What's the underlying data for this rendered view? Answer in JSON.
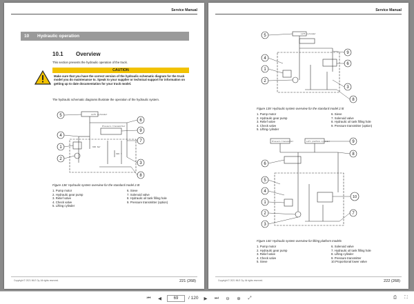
{
  "left_page": {
    "header": "Service Manual",
    "section_number": "10",
    "section_title": "Hydraulic operation",
    "subsection_number": "10.1",
    "subsection_title": "Overview",
    "intro": "This section presents the hydraulic operation of the truck.",
    "caution_title": "CAUTION",
    "caution_text": "Make sure that you have the correct version of the hydraulic schematic diagram for the truck model you do maintenance to. Speak to your supplier or technical support for information on getting up to date documentation for your truck model.",
    "body_text": "The hydraulic schematic diagrams illustrate the operation of the hydraulic system.",
    "figure_caption": "Figure 138: Hydraulic system overview for the standard model 2.0t",
    "legend_left": [
      "1. Pump motor",
      "2. Hydraulic gear pump",
      "3. Relief valve",
      "4. Check valve",
      "5. Lifting cylinder"
    ],
    "legend_right": [
      "6. Sieve",
      "7. Solenoid valve",
      "8. Hydraulic oil tank filling hole",
      "9. Pressure transmitter (option)"
    ],
    "footer_copyright": "Copyright © 2021 MLE Oy. All rights reserved.",
    "page_number": "221 (268)"
  },
  "right_page": {
    "header": "Service Manual",
    "figure1_caption": "Figure 139: Hydraulic system overview for the standard model 2.5t",
    "legend1_left": [
      "1. Pump motor",
      "2. Hydraulic gear pump",
      "3. Relief valve",
      "4. Check valve",
      "5. Lifting cylinder"
    ],
    "legend1_right": [
      "6. Sieve",
      "7. Solenoid valve",
      "8. Hydraulic oil tank filling hole",
      "9. Pressure transmitter (option)"
    ],
    "figure2_caption": "Figure 140: Hydraulic system overview for lifting platform models",
    "legend2_left": [
      "1. Pump motor",
      "2. Hydraulic gear pump",
      "3. Relief valve",
      "4. Check valve",
      "5. Sieve"
    ],
    "legend2_right": [
      "6. Solenoid valve",
      "7. Hydraulic oil tank filling hole",
      "8. Lifting cylinder",
      "9. Pressure transmitter",
      "10.Proportional lower valve"
    ],
    "footer_copyright": "Copyright © 2021 MLE Oy. All rights reserved.",
    "page_number": "222 (268)"
  },
  "diagram_labels": {
    "lift_cylinder": "Lift cylinder",
    "pressure_transmitter": "Pressure transmitter",
    "platform_cylinder": "Lift platform cylinder",
    "values": [
      "100 bar",
      "1 bar",
      "100 l"
    ]
  },
  "toolbar": {
    "current_page": "69",
    "total_pages": "/ 120",
    "icons": [
      "first-page-icon",
      "prev-page-icon",
      "next-page-icon",
      "last-page-icon",
      "zoom-out-icon",
      "zoom-in-icon",
      "fit-page-icon",
      "print-icon",
      "fullscreen-icon"
    ]
  },
  "colors": {
    "caution": "#f2c200",
    "section_bar": "#9a9a9a",
    "viewer_bg": "#8a8a8a"
  }
}
